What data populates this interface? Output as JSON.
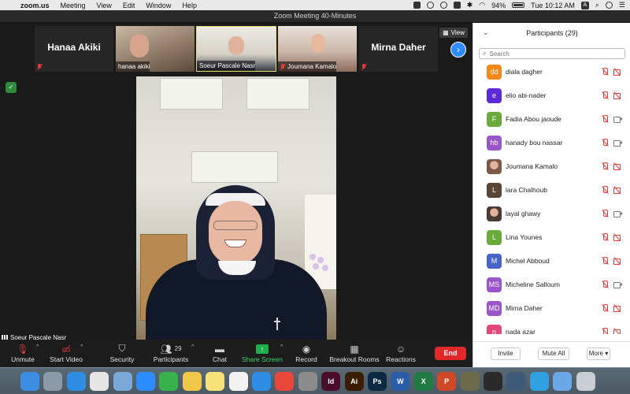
{
  "menubar": {
    "app": "zoom.us",
    "items": [
      "Meeting",
      "View",
      "Edit",
      "Window",
      "Help"
    ],
    "battery": "94%",
    "clock": "Tue 10:12 AM",
    "input_source": "A"
  },
  "window": {
    "title": "Zoom Meeting   40-Minutes"
  },
  "gallery": {
    "tiles": [
      {
        "name": "Hanaa Akiki",
        "style": "name-only"
      },
      {
        "name": "hanaa akiki",
        "style": "video"
      },
      {
        "name": "Soeur Pascale Nasr",
        "style": "video",
        "selected": true
      },
      {
        "name": "Joumana Kamalo",
        "style": "video"
      },
      {
        "name": "Mirna Daher",
        "style": "name-only"
      }
    ],
    "view_label": "View"
  },
  "active_speaker": {
    "name": "Soeur Pascale Nasr"
  },
  "toolbar": {
    "unmute": "Unmute",
    "start_video": "Start Video",
    "security": "Security",
    "participants": "Participants",
    "participants_count": "29",
    "chat": "Chat",
    "share_screen": "Share Screen",
    "record": "Record",
    "breakout_rooms": "Breakout Rooms",
    "reactions": "Reactions",
    "end": "End"
  },
  "participants_panel": {
    "title": "Participants (29)",
    "search_placeholder": "Search",
    "people": [
      {
        "initials": "dd",
        "name": "diala dagher",
        "color": "#f08a1c",
        "video": "off"
      },
      {
        "initials": "e",
        "name": "elio abi-nader",
        "color": "#5a2ad6",
        "video": "off"
      },
      {
        "initials": "F",
        "name": "Fadia Abou jaoude",
        "color": "#6aaa3a",
        "video": "on"
      },
      {
        "initials": "hb",
        "name": "hanady bou nassar",
        "color": "#9a56c8",
        "video": "on"
      },
      {
        "initials": "",
        "name": "Joumana Kamalo",
        "color": "#7b5a48",
        "video": "off",
        "photo": true
      },
      {
        "initials": "L",
        "name": "lara Chalhoub",
        "color": "#5b4636",
        "video": "off"
      },
      {
        "initials": "",
        "name": "layal ghawy",
        "color": "#4a3a32",
        "video": "on",
        "photo": true
      },
      {
        "initials": "L",
        "name": "Lina Younes",
        "color": "#6aaa3a",
        "video": "off"
      },
      {
        "initials": "M",
        "name": "Michel Abboud",
        "color": "#4a63c8",
        "video": "off"
      },
      {
        "initials": "MS",
        "name": "Micheline Salloum",
        "color": "#9a56c8",
        "video": "on"
      },
      {
        "initials": "MD",
        "name": "Mirna Daher",
        "color": "#9a56c8",
        "video": "off"
      },
      {
        "initials": "n",
        "name": "nada azar",
        "color": "#e0487a",
        "video": "off"
      }
    ],
    "invite": "Invite",
    "mute_all": "Mute All",
    "more": "More"
  },
  "dock": {
    "apps": [
      {
        "name": "Finder",
        "color": "#3d8de0",
        "label": ""
      },
      {
        "name": "Launchpad",
        "color": "#8a9aa6",
        "label": ""
      },
      {
        "name": "Safari",
        "color": "#2f8de4",
        "label": ""
      },
      {
        "name": "Chrome",
        "color": "#e6e6e6",
        "label": ""
      },
      {
        "name": "Preview",
        "color": "#7aa6d8",
        "label": ""
      },
      {
        "name": "Zoom",
        "color": "#2d8cff",
        "label": ""
      },
      {
        "name": "FaceTime",
        "color": "#37b24d",
        "label": ""
      },
      {
        "name": "Photos",
        "color": "#f2c84b",
        "label": ""
      },
      {
        "name": "Notes",
        "color": "#f7e27a",
        "label": ""
      },
      {
        "name": "Music",
        "color": "#f2f2f2",
        "label": ""
      },
      {
        "name": "App Store",
        "color": "#2f8de4",
        "label": ""
      },
      {
        "name": "AnyDesk",
        "color": "#e8473c",
        "label": ""
      },
      {
        "name": "System Preferences",
        "color": "#8c8c8c",
        "label": ""
      },
      {
        "name": "InDesign",
        "color": "#4a0d2a",
        "label": "Id"
      },
      {
        "name": "Illustrator",
        "color": "#3a1e04",
        "label": "Ai"
      },
      {
        "name": "Photoshop",
        "color": "#0c2a44",
        "label": "Ps"
      },
      {
        "name": "Word",
        "color": "#2b5ca8",
        "label": "W"
      },
      {
        "name": "Excel",
        "color": "#1f7a44",
        "label": "X"
      },
      {
        "name": "PowerPoint",
        "color": "#d04a28",
        "label": "P"
      },
      {
        "name": "Game",
        "color": "#6b6b4a",
        "label": ""
      },
      {
        "name": "QuickTime",
        "color": "#2a2a2a",
        "label": ""
      },
      {
        "name": "Finder Window",
        "color": "#3d5a78",
        "label": ""
      },
      {
        "name": "Accessibility",
        "color": "#2fa0e0",
        "label": ""
      },
      {
        "name": "Folder",
        "color": "#6aa8e8",
        "label": ""
      },
      {
        "name": "Trash",
        "color": "#c8ced2",
        "label": ""
      }
    ]
  }
}
